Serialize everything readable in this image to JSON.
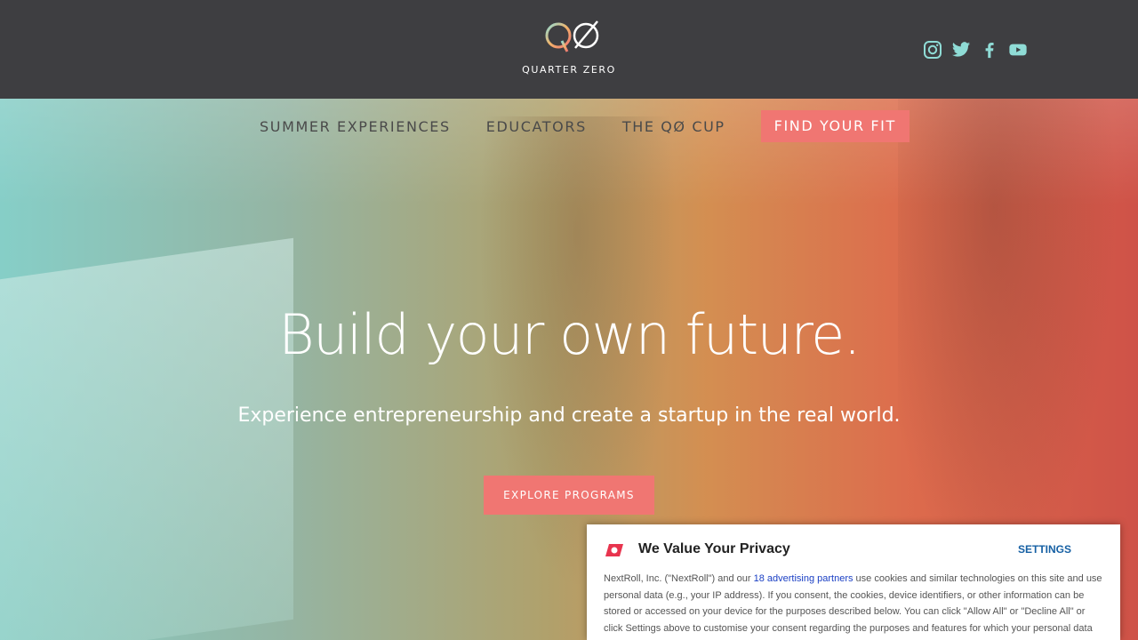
{
  "header": {
    "logo_text": "QUARTER ZERO",
    "social": [
      "instagram-icon",
      "twitter-icon",
      "facebook-icon",
      "youtube-icon"
    ]
  },
  "nav": {
    "items": [
      "SUMMER EXPERIENCES",
      "EDUCATORS",
      "THE QØ CUP"
    ],
    "cta": "FIND YOUR FIT"
  },
  "hero": {
    "headline": "Build your own future.",
    "subhead": "Experience entrepreneurship and create a startup in the real world.",
    "button": "EXPLORE PROGRAMS"
  },
  "privacy": {
    "title": "We Value Your Privacy",
    "settings": "SETTINGS",
    "body_prefix": "NextRoll, Inc. (\"NextRoll\") and our ",
    "body_link": "18 advertising partners",
    "body_suffix": " use cookies and similar technologies on this site and use personal data (e.g., your IP address). If you consent, the cookies, device identifiers, or other information can be stored or accessed on your device for the purposes described below. You can click \"Allow All\" or \"Decline All\" or click Settings above to customise your consent regarding the purposes and features for which your personal data"
  },
  "colors": {
    "accent": "#f07672",
    "topbar": "#3e3e41",
    "social_icon": "#8fdcd6",
    "link": "#1a3fc4"
  }
}
